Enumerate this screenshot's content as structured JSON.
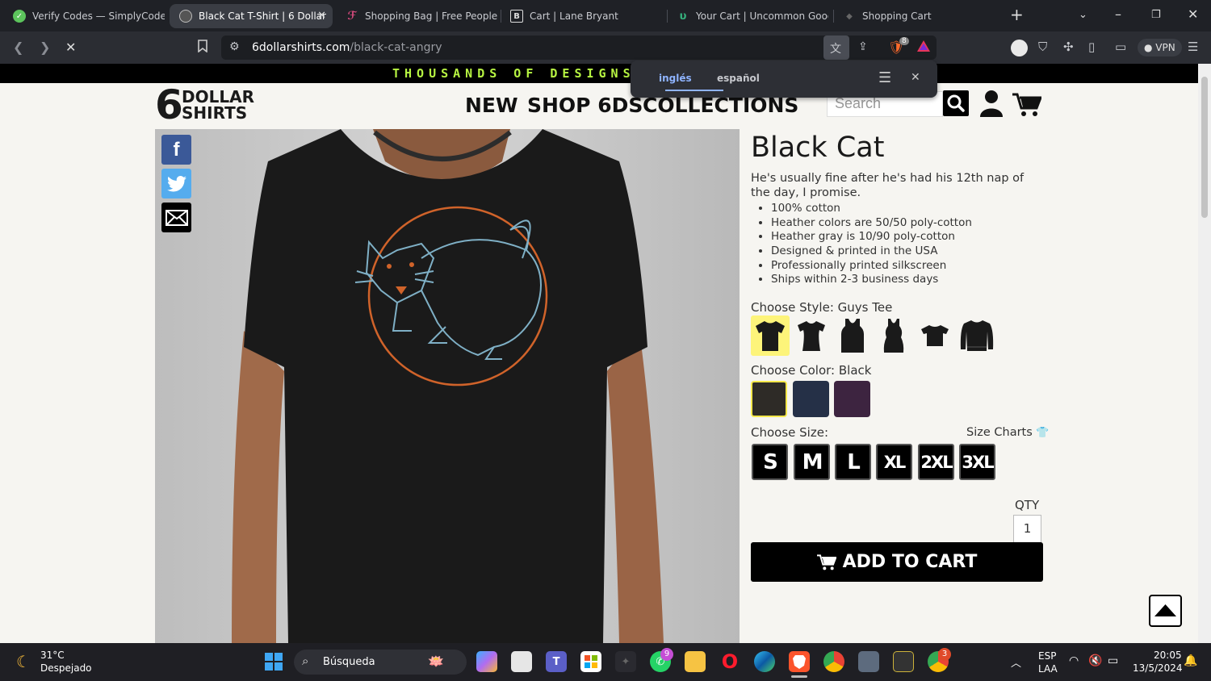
{
  "browser": {
    "tabs": [
      {
        "title": "Verify Codes — SimplyCodes",
        "color": "#5cc45c"
      },
      {
        "title": "Black Cat T-Shirt | 6 Dollar",
        "color": "#bbbbbb"
      },
      {
        "title": "Shopping Bag | Free People",
        "color": "#d64a7c"
      },
      {
        "title": "Cart | Lane Bryant",
        "color": "#dddddd"
      },
      {
        "title": "Your Cart | Uncommon Goods",
        "color": "#36b37e"
      },
      {
        "title": "Shopping Cart",
        "color": "#666666"
      }
    ],
    "url_domain": "6dollarshirts.com",
    "url_path": "/black-cat-angry",
    "vpn_label": "VPN",
    "brave_badge": "8"
  },
  "translate_popup": {
    "lang_from": "inglés",
    "lang_to": "español"
  },
  "promo_banner": "THOUSANDS OF DESIGNS • G",
  "logo": {
    "six": "6",
    "line1": "DOLLAR",
    "line2": "SHIRTS"
  },
  "nav": [
    "NEW",
    "SHOP 6DS",
    "COLLECTIONS"
  ],
  "search": {
    "placeholder": "Search"
  },
  "product": {
    "title": "Black Cat",
    "description": "He's usually fine after he's had his 12th nap of the day, I promise.",
    "features": [
      "100% cotton",
      "Heather colors are 50/50 poly-cotton",
      "Heather gray is 10/90 poly-cotton",
      "Designed & printed in the USA",
      "Professionally printed silkscreen",
      "Ships within 2-3 business days"
    ],
    "style_label": "Choose Style: Guys Tee",
    "color_label": "Choose Color: Black",
    "colors": [
      "#2e2b27",
      "#253047",
      "#3d2440"
    ],
    "size_label": "Choose Size:",
    "size_charts_label": "Size Charts",
    "sizes": [
      "S",
      "M",
      "L",
      "XL",
      "2XL",
      "3XL"
    ],
    "qty_label": "QTY",
    "qty_value": "1",
    "add_to_cart": "ADD TO CART"
  },
  "taskbar": {
    "weather_temp": "31°C",
    "weather_desc": "Despejado",
    "search_label": "Búsqueda",
    "whatsapp_badge": "9",
    "chrome_badge": "3",
    "lang_top": "ESP",
    "lang_bottom": "LAA",
    "time": "20:05",
    "date": "13/5/2024"
  }
}
